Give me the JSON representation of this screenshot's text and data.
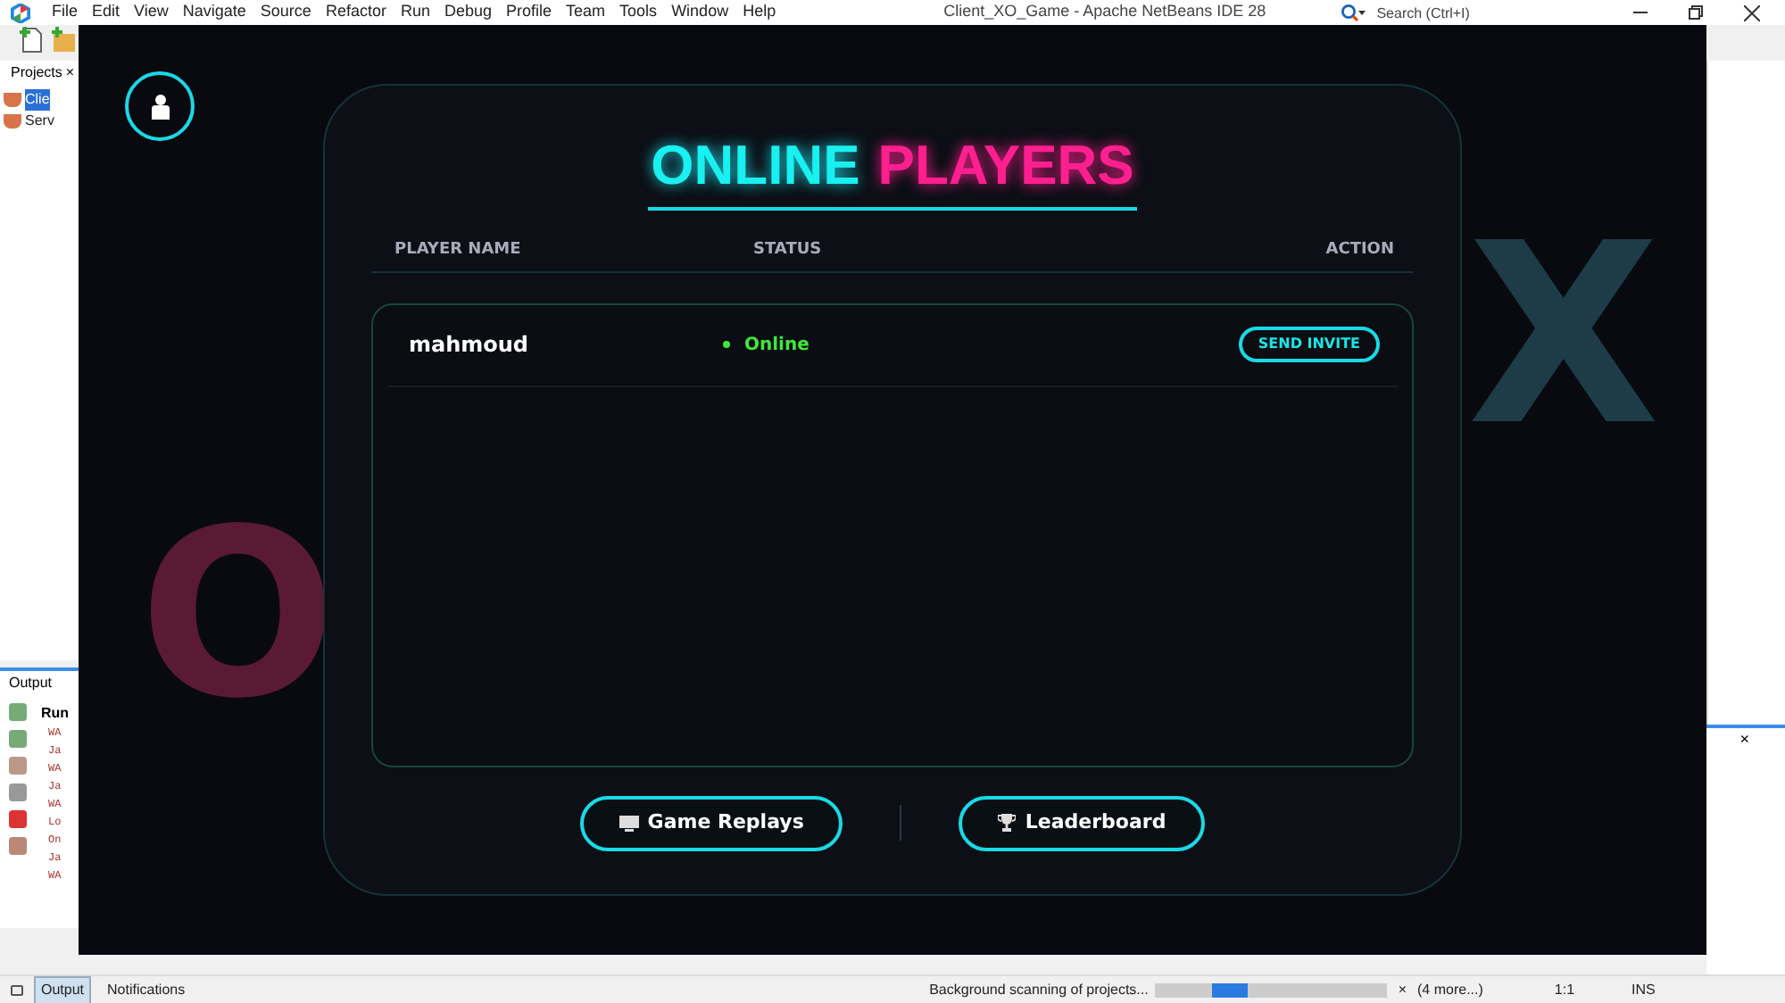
{
  "ide": {
    "menu": [
      "File",
      "Edit",
      "View",
      "Navigate",
      "Source",
      "Refactor",
      "Run",
      "Debug",
      "Profile",
      "Team",
      "Tools",
      "Window",
      "Help"
    ],
    "title": "Client_XO_Game - Apache NetBeans IDE 28",
    "search": {
      "placeholder": "Search (Ctrl+I)"
    },
    "projects": {
      "tab": "Projects",
      "close": "×",
      "items": [
        {
          "label": "Clie",
          "selected": true
        },
        {
          "label": "Serv",
          "selected": false
        }
      ]
    },
    "output": {
      "title": "Output",
      "close": "×",
      "run_label": "Run",
      "lines": [
        "WA",
        "Ja",
        "WA",
        "Ja",
        "WA",
        "Lo",
        "On",
        "Ja",
        "WA"
      ]
    },
    "bottom_tabs": [
      {
        "label": "Output",
        "selected": true
      },
      {
        "label": "Notifications",
        "selected": false
      }
    ],
    "status_bar": {
      "task": "Background scanning of projects...",
      "indeterminate": true,
      "cancel": "×",
      "more": "(4 more...)",
      "position": "1:1",
      "mode": "INS"
    }
  },
  "game": {
    "background_marks": [
      "O",
      "X"
    ],
    "title": [
      "ONLINE",
      "PLAYERS"
    ],
    "columns": [
      "PLAYER NAME",
      "STATUS",
      "ACTION"
    ],
    "players": [
      {
        "name": "mahmoud",
        "status": "Online",
        "online": true,
        "action": "SEND INVITE"
      }
    ],
    "buttons": [
      {
        "kind": "replays",
        "label": "Game Replays"
      },
      {
        "kind": "leaderboard",
        "label": "Leaderboard"
      }
    ]
  }
}
